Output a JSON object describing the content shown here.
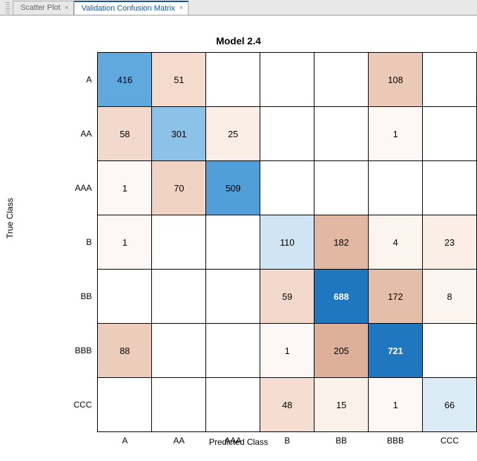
{
  "tabs": [
    {
      "label": "Scatter Plot",
      "active": false
    },
    {
      "label": "Validation Confusion Matrix",
      "active": true
    }
  ],
  "close_glyph": "×",
  "chart_data": {
    "type": "heatmap",
    "title": "Model 2.4",
    "xlabel": "Predicted Class",
    "ylabel": "True Class",
    "row_labels": [
      "A",
      "AA",
      "AAA",
      "B",
      "BB",
      "BBB",
      "CCC"
    ],
    "col_labels": [
      "A",
      "AA",
      "AAA",
      "B",
      "BB",
      "BBB",
      "CCC"
    ],
    "matrix": [
      [
        416,
        51,
        null,
        null,
        null,
        108,
        null
      ],
      [
        58,
        301,
        25,
        null,
        null,
        1,
        null
      ],
      [
        1,
        70,
        509,
        null,
        null,
        null,
        null
      ],
      [
        1,
        null,
        null,
        110,
        182,
        4,
        23
      ],
      [
        null,
        null,
        null,
        59,
        688,
        172,
        8
      ],
      [
        88,
        null,
        null,
        1,
        205,
        721,
        null
      ],
      [
        null,
        null,
        null,
        48,
        15,
        1,
        66
      ]
    ],
    "cell_styles": [
      [
        {
          "bg": "#5fa9de",
          "fg": "#000"
        },
        {
          "bg": "#f4dbce",
          "fg": "#000"
        },
        {
          "bg": "#fff",
          "fg": "#000"
        },
        {
          "bg": "#fff",
          "fg": "#000"
        },
        {
          "bg": "#fff",
          "fg": "#000"
        },
        {
          "bg": "#ecc8b7",
          "fg": "#000"
        },
        {
          "bg": "#fff",
          "fg": "#000"
        }
      ],
      [
        {
          "bg": "#f3d9cb",
          "fg": "#000"
        },
        {
          "bg": "#8cc2e7",
          "fg": "#000"
        },
        {
          "bg": "#faeee7",
          "fg": "#000"
        },
        {
          "bg": "#fff",
          "fg": "#000"
        },
        {
          "bg": "#fff",
          "fg": "#000"
        },
        {
          "bg": "#fdf8f5",
          "fg": "#000"
        },
        {
          "bg": "#fff",
          "fg": "#000"
        }
      ],
      [
        {
          "bg": "#fdf8f5",
          "fg": "#000"
        },
        {
          "bg": "#f0d3c3",
          "fg": "#000"
        },
        {
          "bg": "#519fd8",
          "fg": "#000"
        },
        {
          "bg": "#fff",
          "fg": "#000"
        },
        {
          "bg": "#fff",
          "fg": "#000"
        },
        {
          "bg": "#fff",
          "fg": "#000"
        },
        {
          "bg": "#fff",
          "fg": "#000"
        }
      ],
      [
        {
          "bg": "#fdf8f5",
          "fg": "#000"
        },
        {
          "bg": "#fff",
          "fg": "#000"
        },
        {
          "bg": "#fff",
          "fg": "#000"
        },
        {
          "bg": "#cfe5f3",
          "fg": "#000"
        },
        {
          "bg": "#e2b8a2",
          "fg": "#000"
        },
        {
          "bg": "#fcf4ef",
          "fg": "#000"
        },
        {
          "bg": "#faeee7",
          "fg": "#000"
        }
      ],
      [
        {
          "bg": "#fff",
          "fg": "#000"
        },
        {
          "bg": "#fff",
          "fg": "#000"
        },
        {
          "bg": "#fff",
          "fg": "#000"
        },
        {
          "bg": "#f3d9cb",
          "fg": "#000"
        },
        {
          "bg": "#1f77c0",
          "fg": "#fff",
          "bold": true
        },
        {
          "bg": "#e5bea9",
          "fg": "#000"
        },
        {
          "bg": "#fcf4ef",
          "fg": "#000"
        }
      ],
      [
        {
          "bg": "#eeccbc",
          "fg": "#000"
        },
        {
          "bg": "#fff",
          "fg": "#000"
        },
        {
          "bg": "#fff",
          "fg": "#000"
        },
        {
          "bg": "#fdf8f5",
          "fg": "#000"
        },
        {
          "bg": "#deb099",
          "fg": "#000"
        },
        {
          "bg": "#1f77c0",
          "fg": "#fff",
          "bold": true
        },
        {
          "bg": "#fff",
          "fg": "#000"
        }
      ],
      [
        {
          "bg": "#fff",
          "fg": "#000"
        },
        {
          "bg": "#fff",
          "fg": "#000"
        },
        {
          "bg": "#fff",
          "fg": "#000"
        },
        {
          "bg": "#f5ded1",
          "fg": "#000"
        },
        {
          "bg": "#fbf1eb",
          "fg": "#000"
        },
        {
          "bg": "#fdf8f5",
          "fg": "#000"
        },
        {
          "bg": "#dcecf7",
          "fg": "#000"
        }
      ]
    ]
  }
}
